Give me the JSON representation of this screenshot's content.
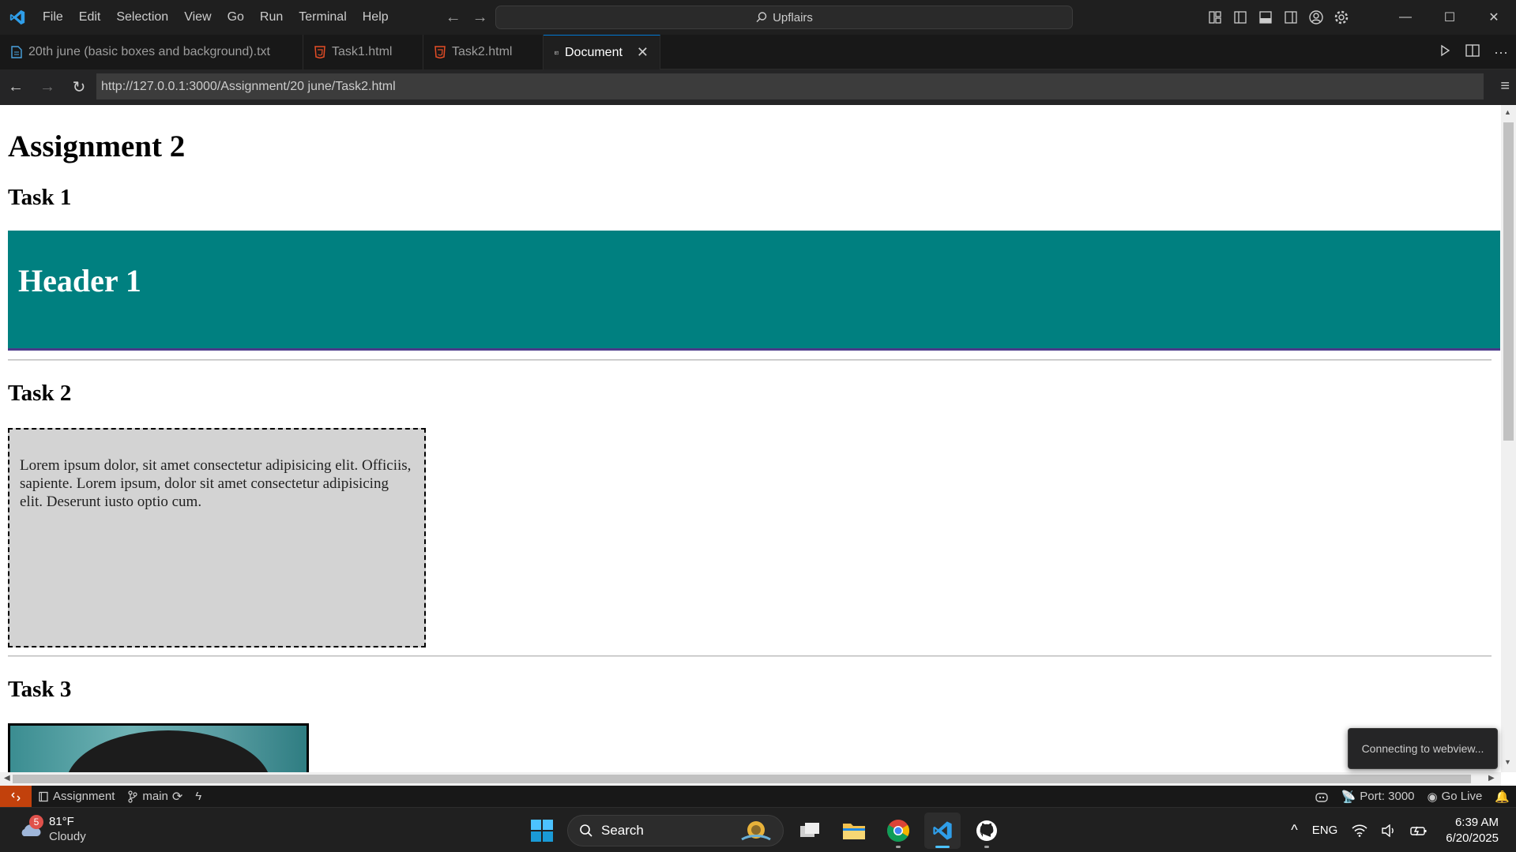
{
  "titlebar": {
    "menu": [
      "File",
      "Edit",
      "Selection",
      "View",
      "Go",
      "Run",
      "Terminal",
      "Help"
    ],
    "command_center": "Upflairs"
  },
  "tabs": [
    {
      "label": "20th june (basic boxes and background).txt",
      "icon": "text-file-icon",
      "color": "#4aa3df"
    },
    {
      "label": "Task1.html",
      "icon": "html-file-icon",
      "color": "#e44d26"
    },
    {
      "label": "Task2.html",
      "icon": "html-file-icon",
      "color": "#e44d26"
    },
    {
      "label": "Document",
      "icon": "preview-icon",
      "color": "#cccccc",
      "active": true
    }
  ],
  "browser": {
    "url": "http://127.0.0.1:3000/Assignment/20 june/Task2.html"
  },
  "page": {
    "title": "Assignment 2",
    "task1": "Task 1",
    "header_text": "Header 1",
    "task2": "Task 2",
    "lorem": "Lorem ipsum dolor, sit amet consectetur adipisicing elit. Officiis, sapiente. Lorem ipsum, dolor sit amet consectetur adipisicing elit. Deserunt iusto optio cum.",
    "task3": "Task 3",
    "header_bg": "#008080",
    "box_bg": "#d3d3d3"
  },
  "toast": "Connecting to webview...",
  "statusbar": {
    "folder": "Assignment",
    "branch": "main",
    "port": "Port: 3000",
    "golive": "Go Live",
    "remote_color": "#c2410c"
  },
  "taskbar": {
    "weather_badge": "5",
    "temperature": "81°F",
    "condition": "Cloudy",
    "search": "Search",
    "lang": "ENG",
    "time": "6:39 AM",
    "date": "6/20/2025"
  }
}
